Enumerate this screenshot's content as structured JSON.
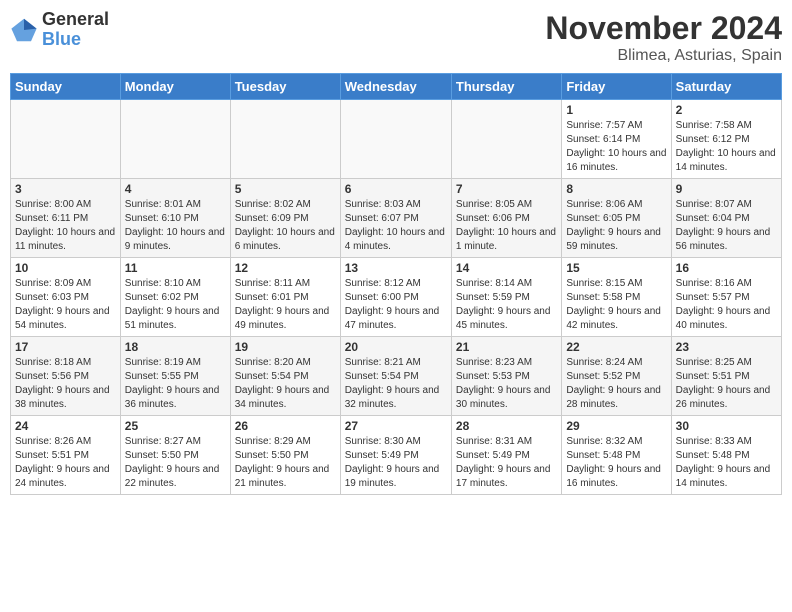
{
  "logo": {
    "general": "General",
    "blue": "Blue"
  },
  "title": "November 2024",
  "location": "Blimea, Asturias, Spain",
  "days_of_week": [
    "Sunday",
    "Monday",
    "Tuesday",
    "Wednesday",
    "Thursday",
    "Friday",
    "Saturday"
  ],
  "weeks": [
    {
      "days": [
        {
          "num": "",
          "info": ""
        },
        {
          "num": "",
          "info": ""
        },
        {
          "num": "",
          "info": ""
        },
        {
          "num": "",
          "info": ""
        },
        {
          "num": "",
          "info": ""
        },
        {
          "num": "1",
          "info": "Sunrise: 7:57 AM\nSunset: 6:14 PM\nDaylight: 10 hours and 16 minutes."
        },
        {
          "num": "2",
          "info": "Sunrise: 7:58 AM\nSunset: 6:12 PM\nDaylight: 10 hours and 14 minutes."
        }
      ]
    },
    {
      "days": [
        {
          "num": "3",
          "info": "Sunrise: 8:00 AM\nSunset: 6:11 PM\nDaylight: 10 hours and 11 minutes."
        },
        {
          "num": "4",
          "info": "Sunrise: 8:01 AM\nSunset: 6:10 PM\nDaylight: 10 hours and 9 minutes."
        },
        {
          "num": "5",
          "info": "Sunrise: 8:02 AM\nSunset: 6:09 PM\nDaylight: 10 hours and 6 minutes."
        },
        {
          "num": "6",
          "info": "Sunrise: 8:03 AM\nSunset: 6:07 PM\nDaylight: 10 hours and 4 minutes."
        },
        {
          "num": "7",
          "info": "Sunrise: 8:05 AM\nSunset: 6:06 PM\nDaylight: 10 hours and 1 minute."
        },
        {
          "num": "8",
          "info": "Sunrise: 8:06 AM\nSunset: 6:05 PM\nDaylight: 9 hours and 59 minutes."
        },
        {
          "num": "9",
          "info": "Sunrise: 8:07 AM\nSunset: 6:04 PM\nDaylight: 9 hours and 56 minutes."
        }
      ]
    },
    {
      "days": [
        {
          "num": "10",
          "info": "Sunrise: 8:09 AM\nSunset: 6:03 PM\nDaylight: 9 hours and 54 minutes."
        },
        {
          "num": "11",
          "info": "Sunrise: 8:10 AM\nSunset: 6:02 PM\nDaylight: 9 hours and 51 minutes."
        },
        {
          "num": "12",
          "info": "Sunrise: 8:11 AM\nSunset: 6:01 PM\nDaylight: 9 hours and 49 minutes."
        },
        {
          "num": "13",
          "info": "Sunrise: 8:12 AM\nSunset: 6:00 PM\nDaylight: 9 hours and 47 minutes."
        },
        {
          "num": "14",
          "info": "Sunrise: 8:14 AM\nSunset: 5:59 PM\nDaylight: 9 hours and 45 minutes."
        },
        {
          "num": "15",
          "info": "Sunrise: 8:15 AM\nSunset: 5:58 PM\nDaylight: 9 hours and 42 minutes."
        },
        {
          "num": "16",
          "info": "Sunrise: 8:16 AM\nSunset: 5:57 PM\nDaylight: 9 hours and 40 minutes."
        }
      ]
    },
    {
      "days": [
        {
          "num": "17",
          "info": "Sunrise: 8:18 AM\nSunset: 5:56 PM\nDaylight: 9 hours and 38 minutes."
        },
        {
          "num": "18",
          "info": "Sunrise: 8:19 AM\nSunset: 5:55 PM\nDaylight: 9 hours and 36 minutes."
        },
        {
          "num": "19",
          "info": "Sunrise: 8:20 AM\nSunset: 5:54 PM\nDaylight: 9 hours and 34 minutes."
        },
        {
          "num": "20",
          "info": "Sunrise: 8:21 AM\nSunset: 5:54 PM\nDaylight: 9 hours and 32 minutes."
        },
        {
          "num": "21",
          "info": "Sunrise: 8:23 AM\nSunset: 5:53 PM\nDaylight: 9 hours and 30 minutes."
        },
        {
          "num": "22",
          "info": "Sunrise: 8:24 AM\nSunset: 5:52 PM\nDaylight: 9 hours and 28 minutes."
        },
        {
          "num": "23",
          "info": "Sunrise: 8:25 AM\nSunset: 5:51 PM\nDaylight: 9 hours and 26 minutes."
        }
      ]
    },
    {
      "days": [
        {
          "num": "24",
          "info": "Sunrise: 8:26 AM\nSunset: 5:51 PM\nDaylight: 9 hours and 24 minutes."
        },
        {
          "num": "25",
          "info": "Sunrise: 8:27 AM\nSunset: 5:50 PM\nDaylight: 9 hours and 22 minutes."
        },
        {
          "num": "26",
          "info": "Sunrise: 8:29 AM\nSunset: 5:50 PM\nDaylight: 9 hours and 21 minutes."
        },
        {
          "num": "27",
          "info": "Sunrise: 8:30 AM\nSunset: 5:49 PM\nDaylight: 9 hours and 19 minutes."
        },
        {
          "num": "28",
          "info": "Sunrise: 8:31 AM\nSunset: 5:49 PM\nDaylight: 9 hours and 17 minutes."
        },
        {
          "num": "29",
          "info": "Sunrise: 8:32 AM\nSunset: 5:48 PM\nDaylight: 9 hours and 16 minutes."
        },
        {
          "num": "30",
          "info": "Sunrise: 8:33 AM\nSunset: 5:48 PM\nDaylight: 9 hours and 14 minutes."
        }
      ]
    }
  ]
}
